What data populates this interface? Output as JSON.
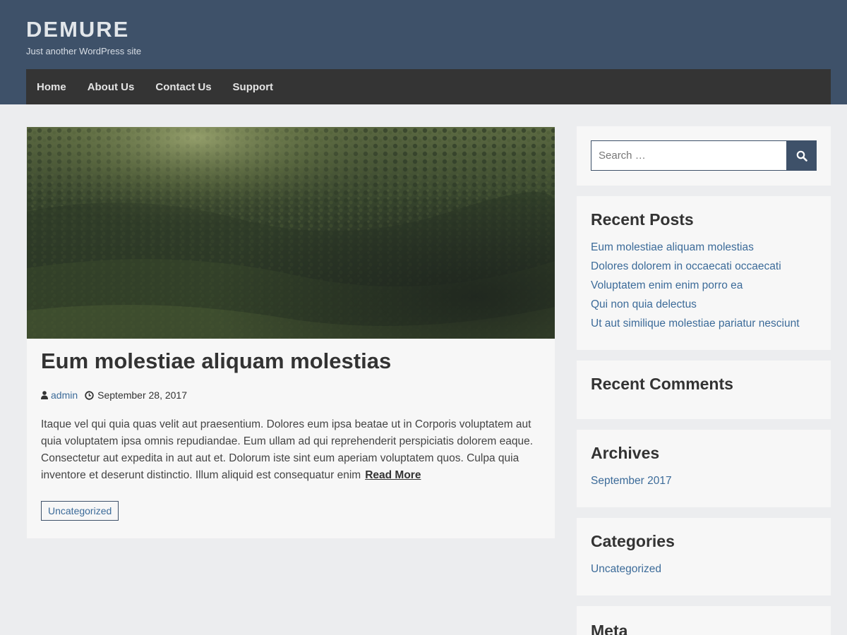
{
  "site": {
    "title": "DEMURE",
    "description": "Just another WordPress site"
  },
  "nav": {
    "items": [
      {
        "label": "Home"
      },
      {
        "label": "About Us"
      },
      {
        "label": "Contact Us"
      },
      {
        "label": "Support"
      }
    ]
  },
  "post": {
    "title": "Eum molestiae aliquam molestias",
    "author": "admin",
    "date": "September 28, 2017",
    "excerpt": "Itaque vel qui quia quas velit aut praesentium. Dolores eum ipsa beatae ut in Corporis voluptatem aut quia voluptatem ipsa omnis repudiandae. Eum ullam ad qui reprehenderit perspiciatis dolorem eaque. Consectetur aut expedita in aut aut et. Dolorum iste sint eum aperiam voluptatem quos. Culpa quia inventore et deserunt distinctio. Illum aliquid est consequatur enim",
    "read_more": "Read More",
    "category": "Uncategorized",
    "image_icon": "forest-image"
  },
  "sidebar": {
    "search": {
      "placeholder": "Search …",
      "button_icon": "search-icon"
    },
    "recent_posts": {
      "title": "Recent Posts",
      "items": [
        "Eum molestiae aliquam molestias",
        "Dolores dolorem in occaecati occaecati",
        "Voluptatem enim enim porro ea",
        "Qui non quia delectus",
        "Ut aut similique molestiae pariatur nesciunt"
      ]
    },
    "recent_comments": {
      "title": "Recent Comments"
    },
    "archives": {
      "title": "Archives",
      "items": [
        "September 2017"
      ]
    },
    "categories": {
      "title": "Categories",
      "items": [
        "Uncategorized"
      ]
    },
    "meta": {
      "title": "Meta"
    }
  },
  "colors": {
    "header_bg": "#3e5169",
    "nav_bg": "#343434",
    "link": "#3c6b99",
    "page_bg": "#ecedef",
    "card_bg": "#f7f7f7"
  }
}
